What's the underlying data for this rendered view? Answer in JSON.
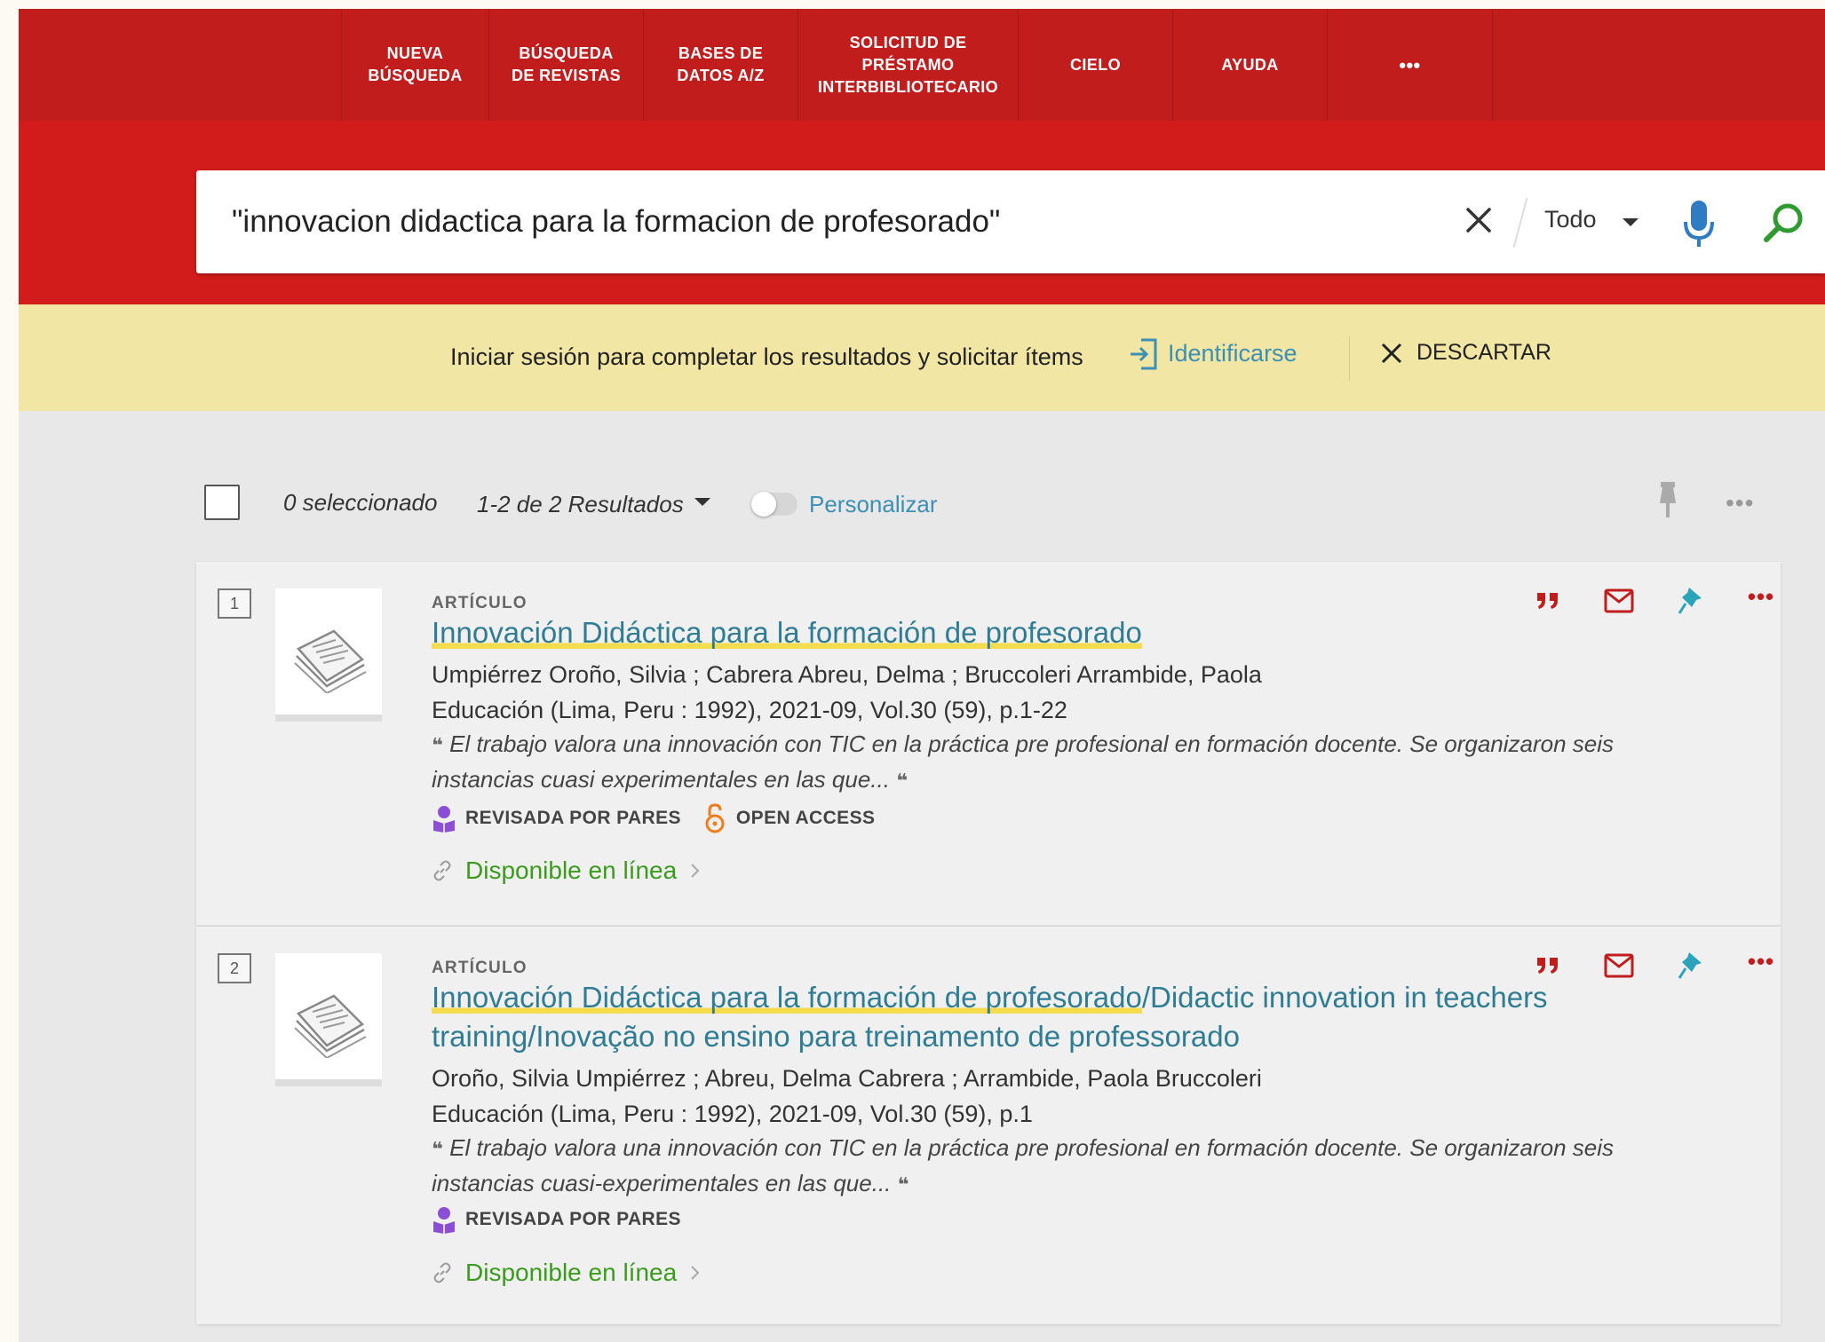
{
  "nav": {
    "items": [
      {
        "label": "NUEVA\nBÚSQUEDA"
      },
      {
        "label": "BÚSQUEDA\nDE REVISTAS"
      },
      {
        "label": "BASES DE\nDATOS A/Z"
      },
      {
        "label": "SOLICITUD DE\nPRÉSTAMO\nINTERBIBLIOTECARIO"
      },
      {
        "label": "CIELO"
      },
      {
        "label": "AYUDA"
      },
      {
        "label": "•••"
      }
    ]
  },
  "search": {
    "query": "\"innovacion didactica para la formacion de profesorado\"",
    "scope": "Todo"
  },
  "notice": {
    "text": "Iniciar sesión para completar los resultados y solicitar ítems",
    "login_label": "Identificarse",
    "dismiss_label": "DESCARTAR"
  },
  "toolbar": {
    "selected": "0 seleccionado",
    "results": "1-2 de 2 Resultados",
    "personalize": "Personalizar",
    "more": "•••"
  },
  "results": [
    {
      "index": "1",
      "type": "ARTÍCULO",
      "title_highlight": "Innovación Didáctica para la formación de profesorado",
      "title_rest": "",
      "authors": "Umpiérrez Oroño, Silvia ; Cabrera Abreu, Delma ; Bruccoleri Arrambide, Paola",
      "source": "Educación (Lima, Peru : 1992), 2021-09, Vol.30 (59), p.1-22",
      "abstract": "El trabajo valora una innovación con TIC en la práctica pre profesional en formación docente. Se organizaron seis instancias cuasi experimentales en las que...",
      "badge_peer": "REVISADA POR PARES",
      "badge_oa": "OPEN ACCESS",
      "availability": "Disponible en línea"
    },
    {
      "index": "2",
      "type": "ARTÍCULO",
      "title_highlight": "Innovación Didáctica para la formación de profesorado",
      "title_rest": "/Didactic innovation in teachers training/Inovação no ensino para treinamento de professorado",
      "authors": "Oroño, Silvia Umpiérrez ; Abreu, Delma Cabrera ; Arrambide, Paola Bruccoleri",
      "source": "Educación (Lima, Peru : 1992), 2021-09, Vol.30 (59), p.1",
      "abstract": "El trabajo valora una innovación con TIC en la práctica pre profesional en formación docente. Se organizaron seis instancias cuasi-experimentales en las que...",
      "badge_peer": "REVISADA POR PARES",
      "availability": "Disponible en línea"
    }
  ],
  "card_more": "•••",
  "colors": {
    "nav_red": "#c21d1d",
    "band_red": "#d21c1c",
    "notice_yellow": "#f1e6a3",
    "link_teal": "#2f7c93",
    "available_green": "#3c9a1f",
    "action_red": "#c21d1d",
    "pin_teal": "#2ba3b8",
    "peer_purple": "#8a4fd4",
    "oa_orange": "#f07c1a"
  },
  "icons": [
    "clear-icon",
    "caret-down-icon",
    "microphone-icon",
    "search-icon",
    "login-icon",
    "close-icon",
    "pin-icon",
    "more-icon",
    "quote-icon",
    "email-icon",
    "peer-reviewed-icon",
    "open-access-icon",
    "link-icon",
    "chevron-right-icon",
    "document-icon"
  ]
}
